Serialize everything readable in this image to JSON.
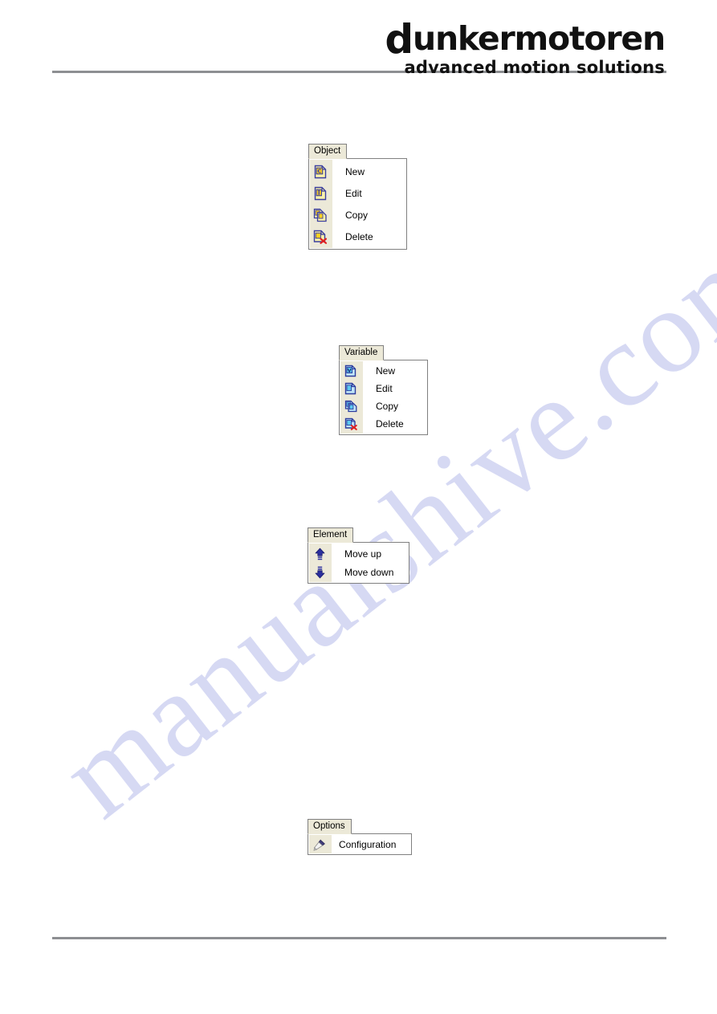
{
  "page": {
    "background_color": "#ffffff",
    "rule_color": "#8d8f92",
    "watermark_text": "manualshive.com",
    "watermark_color": "#c9cdf0"
  },
  "header": {
    "brand_initial": "d",
    "brand_name_rest": "unkermotoren",
    "brand_name_full": "dunkermotoren",
    "tagline": "advanced motion solutions",
    "text_color": "#111111"
  },
  "menus": [
    {
      "id": "object",
      "title": "Object",
      "icon_palette": "yellow",
      "items": [
        {
          "label": "New",
          "icon": "new-document-icon"
        },
        {
          "label": "Edit",
          "icon": "edit-document-icon"
        },
        {
          "label": "Copy",
          "icon": "copy-documents-icon"
        },
        {
          "label": "Delete",
          "icon": "delete-document-icon"
        }
      ]
    },
    {
      "id": "variable",
      "title": "Variable",
      "icon_palette": "blue",
      "items": [
        {
          "label": "New",
          "icon": "new-variable-icon"
        },
        {
          "label": "Edit",
          "icon": "edit-variable-icon"
        },
        {
          "label": "Copy",
          "icon": "copy-variables-icon"
        },
        {
          "label": "Delete",
          "icon": "delete-variable-icon"
        }
      ]
    },
    {
      "id": "element",
      "title": "Element",
      "icon_palette": "arrow",
      "items": [
        {
          "label": "Move up",
          "icon": "arrow-up-icon"
        },
        {
          "label": "Move down",
          "icon": "arrow-down-icon"
        }
      ]
    },
    {
      "id": "options",
      "title": "Options",
      "icon_palette": "tool",
      "items": [
        {
          "label": "Configuration",
          "icon": "screwdriver-icon"
        }
      ]
    }
  ],
  "colors": {
    "menu_title_bg": "#ece9d8",
    "menu_border": "#808080",
    "menu_body_bg": "#ffffff",
    "menu_gutter_bg": "#ece9d8",
    "icon_yellow_fill": "#fbf3a8",
    "icon_yellow_border": "#3b3fa0",
    "icon_blue_fill": "#bfe4f7",
    "icon_blue_border": "#2d3d9e",
    "icon_arrow_blue": "#2b2f9e",
    "icon_delete_red": "#e02020",
    "icon_tool_dark": "#403c7a"
  }
}
